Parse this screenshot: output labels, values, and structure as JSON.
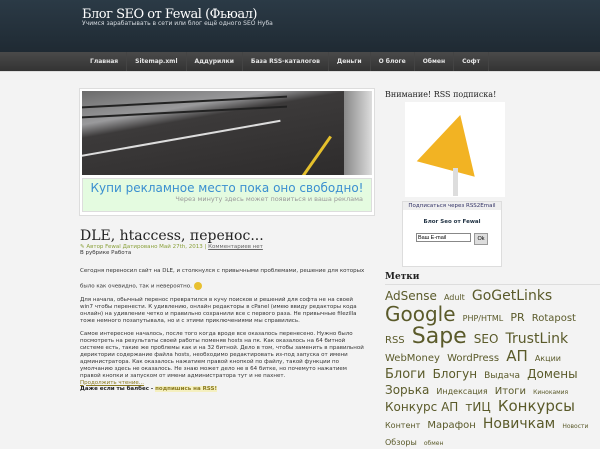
{
  "header": {
    "title": "Блог SEO от Fewal (Фьюал)",
    "tagline": "Учимся зарабатывать в сети или блог ещё одного SEO Нуба"
  },
  "nav": [
    "Главная",
    "Sitemap.xml",
    "Аддурилки",
    "База RSS-каталогов",
    "Деньги",
    "О блоге",
    "Обмен",
    "Софт"
  ],
  "ad": {
    "headline": "Купи рекламное место пока оно свободно!",
    "subline": "Через минуту здесь может появиться и ваша реклама"
  },
  "post": {
    "title": "DLE, htaccess, перенос...",
    "meta_author": "Автор Fewal Датировано Май 27th, 2013 |",
    "comments": "Комментариев нет",
    "category": "В рубрике Работа",
    "p1a": "Сегодня переносил сайт на DLE, и столкнулся с привычными проблемами, решение для которых",
    "p1b": "было как очевидно, так и невероятно.",
    "p2": [
      "Для начала, обычный перенос превратился в кучу поисков и решений для софта не на своей",
      "win7 чтобы перенести. К удивлению, онлайн редакторы в cPanel (имею ввиду редакторы кода",
      "онлайн) на удивление четко и правильно сохранили все с первого раза. Не привычные filezilla",
      "тоже немного позапутывала, но и с этими приключениями мы справились."
    ],
    "p3": [
      "Самое интересное началось, после того когда вроде все оказалось перенесено. Нужно было",
      "посмотреть на результаты своей работы поменяв hosts на пк. Как оказалось на 64 битной",
      "системе есть, такие же проблемы как и на 32 битной. Дело в том, чтобы заменить в правильной",
      "дериктории содержание файла hosts, необходимо редактировать из-под запуска от имени",
      "администратора. Как оказалось нажатием правой кнопкой по файлу, такой функции по",
      "умолчанию здесь не оказалось. Не знаю может дело не в 64 битке, но почемуто нажатием",
      "правой кнопки и запуском от имени администратора тут и не пахнет."
    ],
    "more": "Продолжить чтение...",
    "rss_prefix": "Даже если ты балбес -",
    "rss_link": "подпишись на RSS!"
  },
  "sidebar": {
    "rss_title": "Внимание! RSS подписка!",
    "subscribe_header": "Подписаться через RSS2Email",
    "blog_name": "Блог Seo от Fewal",
    "email_value": "Ваш E-mail",
    "ok": "Ok",
    "tags_title": "Метки",
    "tags": [
      [
        "AdSense",
        12
      ],
      [
        "Adult",
        8
      ],
      [
        "GoGetLinks",
        14
      ],
      [
        "Google",
        20
      ],
      [
        "PHP/HTML",
        8
      ],
      [
        "PR",
        11
      ],
      [
        "Rotapost",
        10
      ],
      [
        "RSS",
        10
      ],
      [
        "Sape",
        22
      ],
      [
        "SEO",
        12
      ],
      [
        "TrustLink",
        14
      ],
      [
        "WebMoney",
        10
      ],
      [
        "WordPress",
        10
      ],
      [
        "АП",
        15
      ],
      [
        "Акции",
        8
      ],
      [
        "Блоги",
        13
      ],
      [
        "Блогун",
        12
      ],
      [
        "Выдача",
        9
      ],
      [
        "Домены",
        12
      ],
      [
        "Зорька",
        12
      ],
      [
        "Индексация",
        8
      ],
      [
        "Итоги",
        10
      ],
      [
        "Кинокамия",
        6
      ],
      [
        "Конкурс АП",
        12
      ],
      [
        "тИЦ",
        12
      ],
      [
        "Конкурсы",
        15
      ],
      [
        "Контент",
        8
      ],
      [
        "Марафон",
        10
      ],
      [
        "Новичкам",
        14
      ],
      [
        "Новости",
        6
      ],
      [
        "Обзоры",
        8
      ],
      [
        "обмен",
        6
      ]
    ]
  }
}
